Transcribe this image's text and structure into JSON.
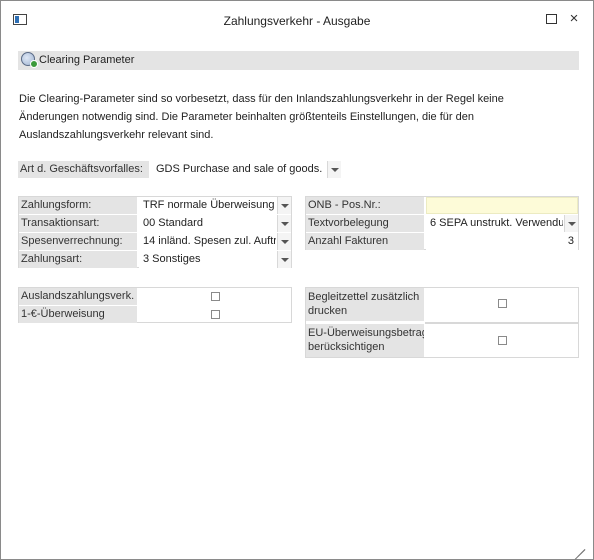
{
  "window": {
    "title": "Zahlungsverkehr - Ausgabe",
    "icons": {
      "app": "window-app-icon",
      "maximize": "maximize-icon",
      "close": "close-icon"
    },
    "close_glyph": "×"
  },
  "section": {
    "label": "Clearing Parameter",
    "icon": "gear-refresh-icon"
  },
  "description": {
    "lines": [
      "Die Clearing-Parameter sind so vorbesetzt, dass für den Inlandszahlungsverkehr in der Regel keine",
      "Änderungen notwendig sind. Die Parameter beinhalten größtenteils Einstellungen, die für den",
      "Auslandszahlungsverkehr relevant sind."
    ]
  },
  "geschaeftsvorfall": {
    "label": "Art d. Geschäftsvorfalles:",
    "value": "GDS  Purchase and sale of goods. P"
  },
  "left_fields": {
    "zahlungsform": {
      "label": "Zahlungsform:",
      "value": "TRF  normale Überweisung"
    },
    "transaktionsart": {
      "label": "Transaktionsart:",
      "value": "00 Standard"
    },
    "spesenverrechnung": {
      "label": "Spesenverrechnung:",
      "value": "14  inländ. Spesen zul. Auftr"
    },
    "zahlungsart": {
      "label": "Zahlungsart:",
      "value": "3 Sonstiges"
    }
  },
  "right_fields": {
    "onb_pos": {
      "label": "ONB - Pos.Nr.:",
      "value": ""
    },
    "textvorbelegung": {
      "label": "Textvorbelegung",
      "value": "6 SEPA unstrukt. Verwendun"
    },
    "anzahl_fakturen": {
      "label": "Anzahl Fakturen",
      "value": "3"
    }
  },
  "left_checkboxes": {
    "auslandszahlungsverk": {
      "label": "Auslandszahlungsverk.",
      "checked": false
    },
    "ein_euro_ueberweisung": {
      "label": "1-€-Überweisung",
      "checked": false
    }
  },
  "right_checkboxes": {
    "begleitzettel": {
      "label_line1": "Begleitzettel zusätzlich",
      "label_line2": "drucken",
      "checked": false
    },
    "eu_ueberweisungsbetrag": {
      "label_line1": "EU-Überweisungsbetrag",
      "label_line2": "berücksichtigen",
      "checked": false
    }
  },
  "colors": {
    "label_bg": "#e4e4e4",
    "highlight_field": "#fdfbd8",
    "border": "#d8d8d8"
  }
}
